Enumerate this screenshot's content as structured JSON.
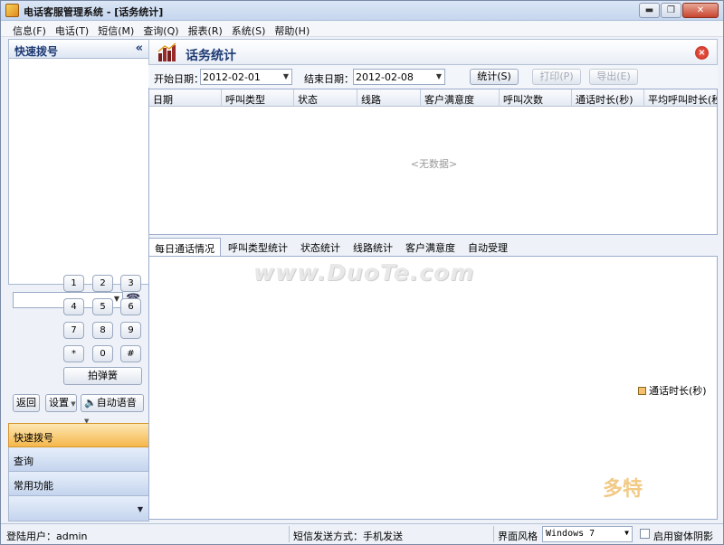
{
  "window": {
    "title": "电话客服管理系统 - [话务统计]",
    "buttons": [
      "▬",
      "❐",
      "✕"
    ]
  },
  "menu": [
    "信息(F)",
    "电话(T)",
    "短信(M)",
    "查询(Q)",
    "报表(R)",
    "系统(S)",
    "帮助(H)"
  ],
  "left": {
    "header": "快速拨号",
    "collapse": "«",
    "keys": [
      "1",
      "2",
      "3",
      "4",
      "5",
      "6",
      "7",
      "8",
      "9",
      "*",
      "0",
      "#"
    ],
    "flash_button": "拍弹簧",
    "back_button": "返回",
    "settings_button": "设置",
    "auto_voice_button": "自动语音",
    "nav": [
      "快速拨号",
      "查询",
      "常用功能"
    ]
  },
  "right": {
    "title": "话务统计",
    "start_label": "开始日期：",
    "start_value": "2012-02-01",
    "end_label": "结束日期：",
    "end_value": "2012-02-08",
    "stats_button": "统计(S)",
    "print_button": "打印(P)",
    "export_button": "导出(E)",
    "columns": [
      "日期",
      "呼叫类型",
      "状态",
      "线路",
      "客户满意度",
      "呼叫次数",
      "通话时长(秒)",
      "平均呼叫时长(秒"
    ],
    "no_data": "<无数据>",
    "tabs": [
      "每日通话情况",
      "呼叫类型统计",
      "状态统计",
      "线路统计",
      "客户满意度",
      "自动受理"
    ],
    "legend": "通话时长(秒)",
    "watermark": "www.DuoTe.com"
  },
  "status": {
    "user": "登陆用户：admin",
    "sms_mode": "短信发送方式：手机发送",
    "theme_label": "界面风格",
    "theme_value": "Windows 7",
    "shadow_label": "启用窗体阴影",
    "logo": "多特"
  },
  "colors": {
    "accent_orange": "#f5b74c",
    "legend_swatch": "#f4c070",
    "title_blue": "#1e3a74"
  }
}
